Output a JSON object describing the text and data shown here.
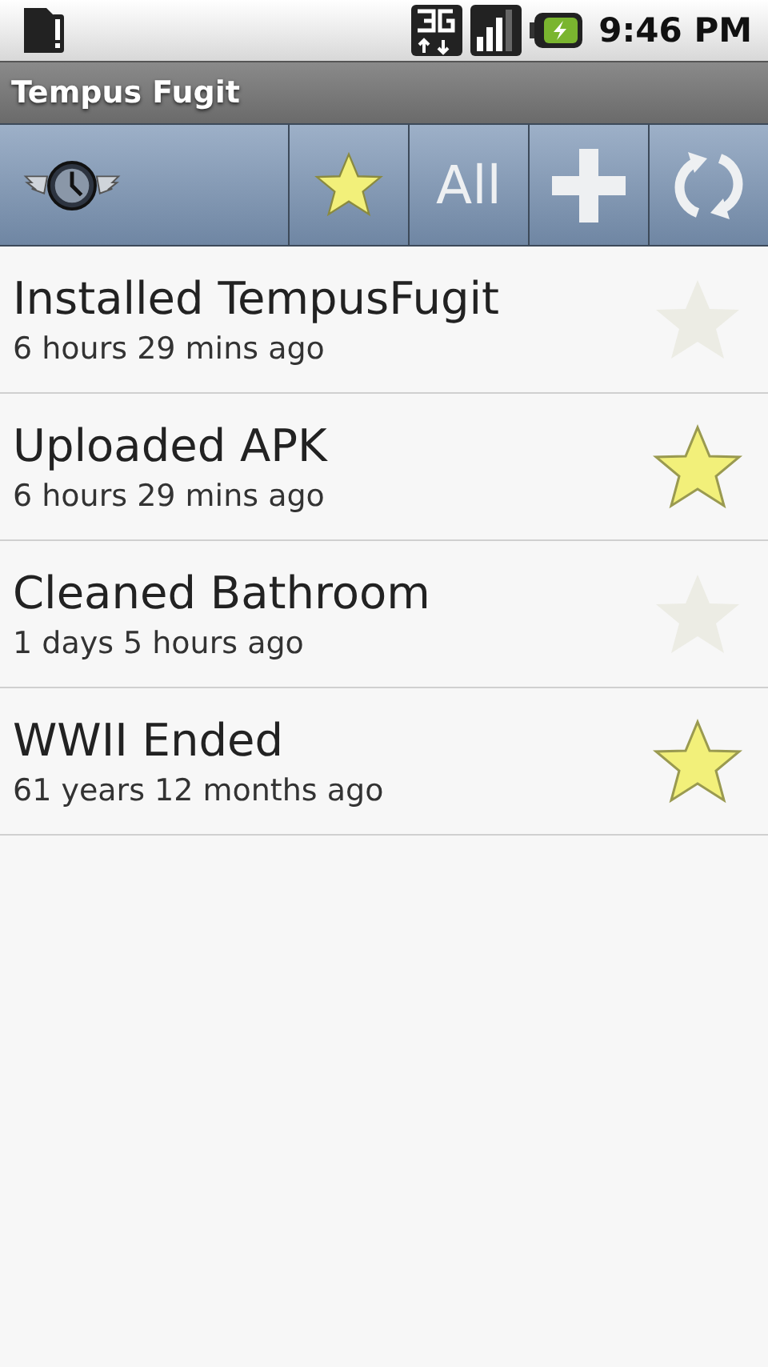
{
  "status_bar": {
    "time": "9:46 PM"
  },
  "window": {
    "title": "Tempus Fugit"
  },
  "toolbar": [
    {
      "kind": "logo"
    },
    {
      "kind": "star"
    },
    {
      "kind": "text",
      "label": "All"
    },
    {
      "kind": "add"
    },
    {
      "kind": "refresh"
    }
  ],
  "events": [
    {
      "title": "Installed TempusFugit",
      "elapsed": "6 hours 29 mins  ago",
      "starred": false
    },
    {
      "title": "Uploaded APK",
      "elapsed": "6 hours 29 mins  ago",
      "starred": true
    },
    {
      "title": "Cleaned Bathroom",
      "elapsed": "1 days 5 hours  ago",
      "starred": false
    },
    {
      "title": "WWII Ended",
      "elapsed": "61 years 12 months  ago",
      "starred": true
    }
  ]
}
